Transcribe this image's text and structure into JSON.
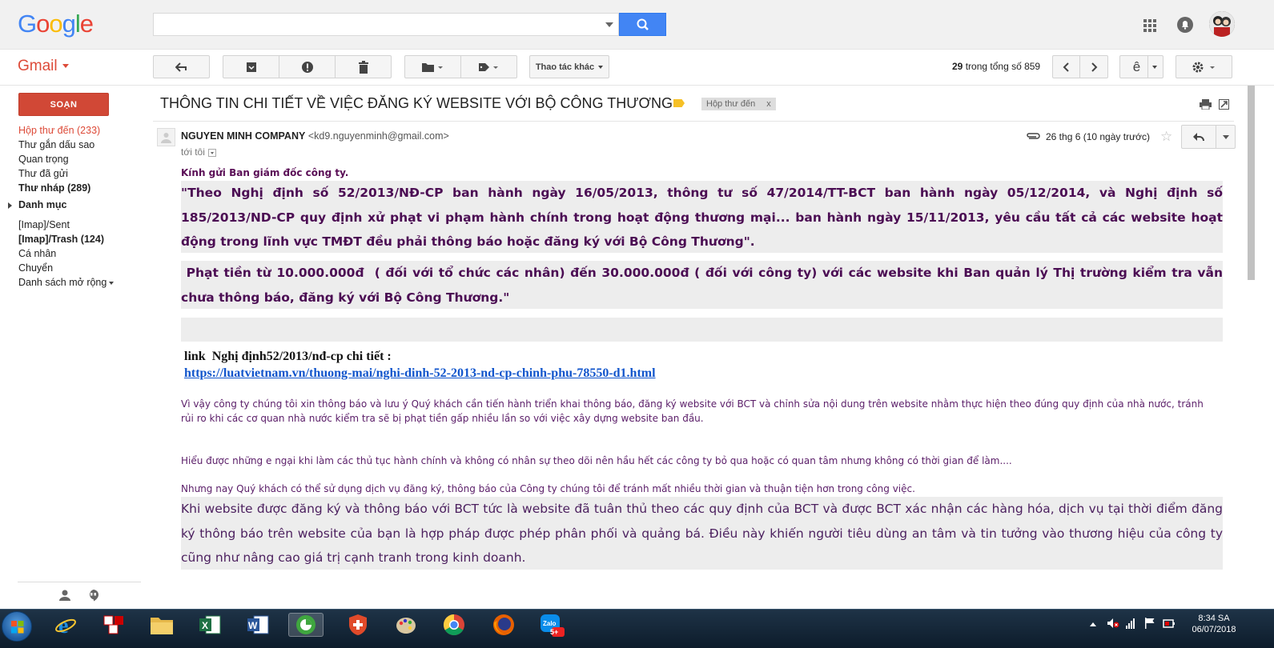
{
  "header": {
    "logo_letters": [
      {
        "ch": "G",
        "color": "#4285f4"
      },
      {
        "ch": "o",
        "color": "#ea4335"
      },
      {
        "ch": "o",
        "color": "#fbbc05"
      },
      {
        "ch": "g",
        "color": "#4285f4"
      },
      {
        "ch": "l",
        "color": "#34a853"
      },
      {
        "ch": "e",
        "color": "#ea4335"
      }
    ],
    "search_value": "",
    "search_placeholder": ""
  },
  "toolbar": {
    "gmail_label": "Gmail",
    "more_actions_label": "Thao tác khác",
    "count_current": "29",
    "count_text": "trong tổng số 859",
    "input_tool_label": "ê"
  },
  "sidebar": {
    "compose_label": "SOẠN",
    "items": [
      {
        "label": "Hộp thư đến (233)",
        "active": true,
        "bold": false
      },
      {
        "label": "Thư gắn dấu sao",
        "active": false,
        "bold": false
      },
      {
        "label": "Quan trọng",
        "active": false,
        "bold": false
      },
      {
        "label": "Thư đã gửi",
        "active": false,
        "bold": false
      },
      {
        "label": "Thư nháp (289)",
        "active": false,
        "bold": true
      }
    ],
    "section_label": "Danh mục",
    "items2": [
      {
        "label": "[Imap]/Sent",
        "bold": false
      },
      {
        "label": "[Imap]/Trash (124)",
        "bold": true
      },
      {
        "label": "Cá nhân",
        "bold": false
      },
      {
        "label": "Chuyển",
        "bold": false
      },
      {
        "label": "Danh sách mở rộng",
        "bold": false
      }
    ]
  },
  "email": {
    "subject": "THÔNG TIN CHI TIẾT VỀ VIỆC ĐĂNG KÝ WEBSITE VỚI BỘ CÔNG THƯƠNG",
    "inbox_chip": "Hộp thư đến",
    "inbox_chip_close": "x",
    "sender_name": "NGUYEN MINH COMPANY",
    "sender_email": "<kd9.nguyenminh@gmail.com>",
    "to_me": "tới tôi",
    "date": "26 thg 6 (10 ngày trước)",
    "greeting": "Kính gửi Ban giám đốc công ty.",
    "quote1": "\"Theo Nghị định số 52/2013/NĐ-CP ban hành ngày 16/05/2013, thông tư số 47/2014/TT-BCT ban hành ngày 05/12/2014, và Nghị định số 185/2013/ND-CP quy định xử phạt vi phạm hành chính trong hoạt động thương mại... ban hành ngày 15/11/2013, yêu cầu tất cả các website hoạt động trong lĩnh vực TMĐT đều phải thông báo hoặc đăng ký với Bộ Công Thương\".",
    "quote2": " Phạt tiền từ 10.000.000đ  ( đối với tổ chức các nhân) đến 30.000.000đ ( đối với công ty) với các website khi Ban quản lý Thị trường kiểm tra vẫn chưa thông báo, đăng ký với Bộ Công Thương.\"",
    "link_label": "link  Nghị định52/2013/nđ-cp chi tiết :",
    "link_url": "https://luatvietnam.vn/thuong-mai/nghi-dinh-52-2013-nd-cp-chinh-phu-78550-d1.html",
    "para1": "Vì vậy công ty chúng tôi xin thông báo và lưu ý Quý khách  cần tiến hành triển khai thông báo, đăng ký website với BCT và chỉnh sửa nội dung trên website  nhằm thực hiện theo đúng quy định của nhà nước, tránh rủi ro khi các cơ quan nhà nước kiểm tra sẽ bị phạt tiền gấp nhiều lần so với việc xây dựng website ban đầu.",
    "para2": "Hiểu được những e ngại khi làm các thủ tục hành chính và không có nhân sự theo dõi nên hầu hết các công ty  bỏ qua hoặc có quan tâm nhưng không có thời gian để làm....",
    "para3": "Nhưng nay Quý khách có thể sử dụng dịch vụ đăng ký, thông báo  của Công ty chúng tôi để tránh mất nhiều thời gian và thuận tiện hơn trong công việc.",
    "para4": "Khi website được đăng ký và thông báo với BCT tức là website đã tuân thủ theo các quy định của BCT và được BCT xác nhận các hàng hóa, dịch vụ tại thời điểm đăng ký thông báo trên website của bạn là hợp pháp được phép phân phối và quảng bá. Điều này khiến người tiêu dùng an tâm và tin tưởng vào thương hiệu của công ty cũng như nâng cao giá trị cạnh tranh trong kinh doanh."
  },
  "taskbar": {
    "time": "8:34 SA",
    "date": "06/07/2018",
    "zalo_badge": "5+"
  },
  "colors": {
    "gmail_red": "#dd4b39",
    "compose_red": "#d14836",
    "search_blue": "#4285f4",
    "body_purple": "#4b0d53",
    "link_blue": "#1155cc"
  }
}
